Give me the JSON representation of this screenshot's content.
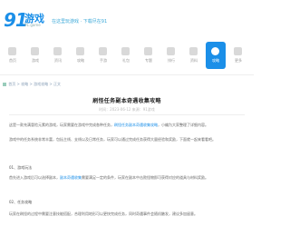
{
  "logo": {
    "mark": "91",
    "name": "游戏",
    "sub": "91.game",
    "slogan": "在这里玩游戏 · 下载尽在91"
  },
  "nav": {
    "items": [
      {
        "label": "首页",
        "icon": "home-icon"
      },
      {
        "label": "游戏",
        "icon": "game-icon"
      },
      {
        "label": "资讯",
        "icon": "news-icon"
      },
      {
        "label": "攻略",
        "icon": "guide-icon"
      },
      {
        "label": "手游",
        "icon": "mobile-icon"
      },
      {
        "label": "礼包",
        "icon": "gift-icon"
      },
      {
        "label": "专题",
        "icon": "topic-icon"
      },
      {
        "label": "排行",
        "icon": "rank-icon"
      },
      {
        "label": "资料",
        "icon": "data-icon"
      },
      {
        "label": "攻略",
        "icon": "guide-active-icon"
      },
      {
        "label": "更多",
        "icon": "more-icon"
      }
    ],
    "active_index": 9,
    "colors": {
      "active": "#1b8fe8",
      "icon": "#d9d9d9"
    }
  },
  "breadcrumb": {
    "text": "首页 > 攻略 > 游戏攻略 > 正文"
  },
  "article": {
    "title": "刷怪任务副本奇遇收集攻略",
    "meta": "时间：2023-06-12  来源：91游戏",
    "paragraphs": [
      {
        "prefix": "这是一款充满冒险元素的游戏，玩家需要在游戏中完成各种任务，",
        "highlight": "刷怪任务副本奇遇收集攻略",
        "suffix": "，小编为大家整理了详细内容。"
      },
      {
        "prefix": "游戏中的任务系统非常丰富，包括主线、支线以及日常任务，玩家可以通过完成任务获得大量经验和奖励，",
        "highlight": "",
        "suffix": "下面就一起来看看吧。"
      }
    ],
    "sub_heading": "01、游戏玩法",
    "paragraphs2": [
      {
        "prefix": "首先进入游戏后可以选择副本，",
        "highlight": "副本奇遇收集",
        "suffix": "需要满足一定的条件，玩家在副本中击败怪物即可获得对应的道具与材料奖励。"
      }
    ],
    "sub_heading2": "02、任务攻略",
    "paragraphs3": [
      {
        "prefix": "玩家在刷怪的过程中需要注意技能搭配，合理利用地形可以更快完成任务，",
        "highlight": "",
        "suffix": "同时奇遇事件会随机触发，建议多加留意。"
      }
    ]
  }
}
